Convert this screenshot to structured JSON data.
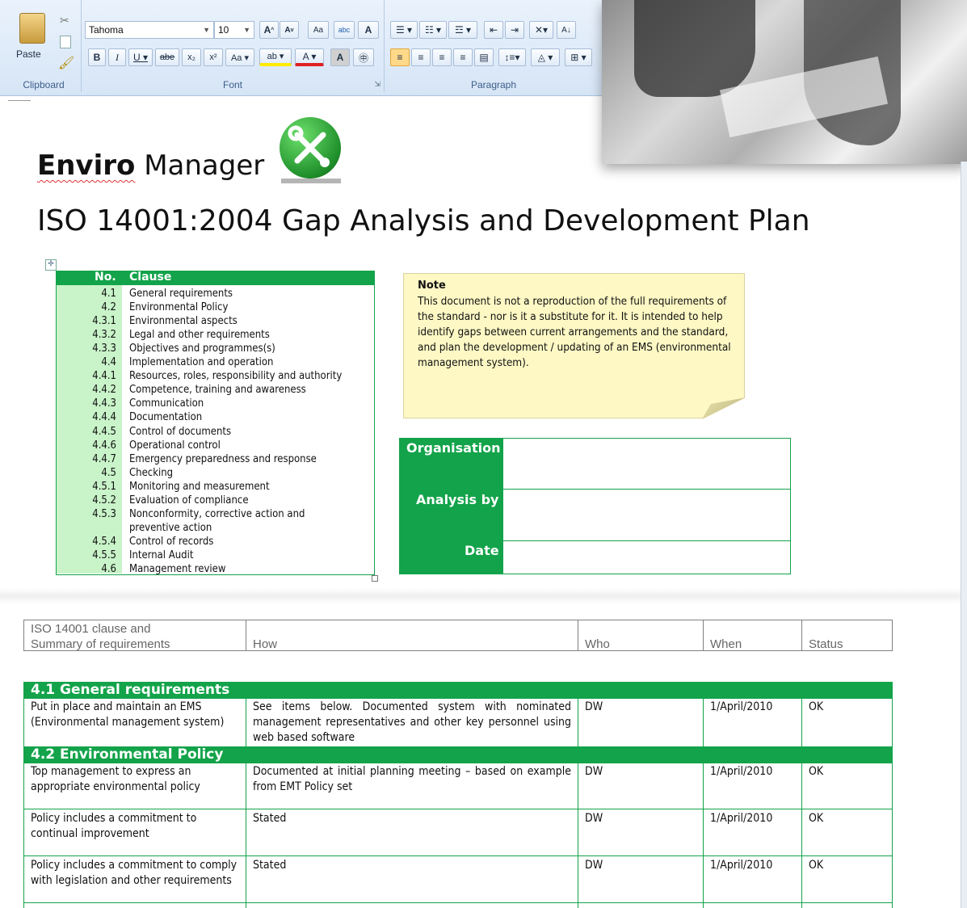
{
  "ribbon": {
    "clipboard": {
      "paste_label": "Paste",
      "group_title": "Clipboard"
    },
    "font": {
      "family": "Tahoma",
      "size": "10",
      "group_title": "Font"
    },
    "paragraph": {
      "group_title": "Paragraph"
    }
  },
  "brand": {
    "name_bold": "Enviro",
    "name_rest": "Manager"
  },
  "document": {
    "title": "ISO 14001:2004 Gap Analysis and Development Plan"
  },
  "clauses": {
    "header_no": "No.",
    "header_clause": "Clause",
    "items": [
      {
        "no": "4.1",
        "label": "General requirements"
      },
      {
        "no": "4.2",
        "label": "Environmental Policy"
      },
      {
        "no": "4.3.1",
        "label": "Environmental aspects"
      },
      {
        "no": "4.3.2",
        "label": "Legal and other requirements"
      },
      {
        "no": "4.3.3",
        "label": "Objectives and programmes(s)"
      },
      {
        "no": "4.4",
        "label": "Implementation and operation"
      },
      {
        "no": "4.4.1",
        "label": "Resources, roles, responsibility and authority"
      },
      {
        "no": "4.4.2",
        "label": "Competence, training and awareness"
      },
      {
        "no": "4.4.3",
        "label": "Communication"
      },
      {
        "no": "4.4.4",
        "label": "Documentation"
      },
      {
        "no": "4.4.5",
        "label": "Control of documents"
      },
      {
        "no": "4.4.6",
        "label": "Operational control"
      },
      {
        "no": "4.4.7",
        "label": "Emergency preparedness and response"
      },
      {
        "no": "4.5",
        "label": "Checking"
      },
      {
        "no": "4.5.1",
        "label": "Monitoring and measurement"
      },
      {
        "no": "4.5.2",
        "label": "Evaluation of compliance"
      },
      {
        "no": "4.5.3",
        "label": "Nonconformity, corrective action and"
      },
      {
        "no": "",
        "label": "preventive action"
      },
      {
        "no": "4.5.4",
        "label": "Control of records"
      },
      {
        "no": "4.5.5",
        "label": "Internal Audit"
      },
      {
        "no": "4.6",
        "label": "Management review"
      }
    ]
  },
  "note": {
    "title": "Note",
    "body": "This document is not a reproduction of the full requirements of the standard - nor is it a substitute for it. It is intended to help identify gaps between current arrangements and the standard, and plan the development / updating of an EMS (environmental management system)."
  },
  "org_table": {
    "organisation_label": "Organisation",
    "analysis_label": "Analysis by",
    "date_label": "Date"
  },
  "gap_table": {
    "headers": {
      "clause_line1": "ISO 14001 clause and",
      "clause_line2": "Summary of requirements",
      "how": "How",
      "who": "Who",
      "when": "When",
      "status": "Status"
    },
    "section_1": "4.1 General requirements",
    "section_2": "4.2 Environmental Policy",
    "rows": [
      {
        "req": "Put in place and maintain an EMS (Environmental management system)",
        "how": "See items below. Documented system with nominated management representatives and other key personnel using web based software",
        "who": "DW",
        "when": "1/April/2010",
        "status": "OK"
      },
      {
        "req": "Top management to express an appropriate environmental policy",
        "how": "Documented at initial planning meeting – based on example from EMT Policy set",
        "who": "DW",
        "when": "1/April/2010",
        "status": "OK"
      },
      {
        "req": "Policy includes a commitment to continual improvement",
        "how": "Stated",
        "who": "DW",
        "when": "1/April/2010",
        "status": "OK"
      },
      {
        "req": "Policy includes a commitment to comply with legislation and other requirements",
        "how": "Stated",
        "who": "DW",
        "when": "1/April/2010",
        "status": "OK"
      }
    ]
  },
  "colors": {
    "accent_green": "#13a34a",
    "light_green": "#c9f3c9",
    "note_yellow": "#fdf8c4"
  }
}
